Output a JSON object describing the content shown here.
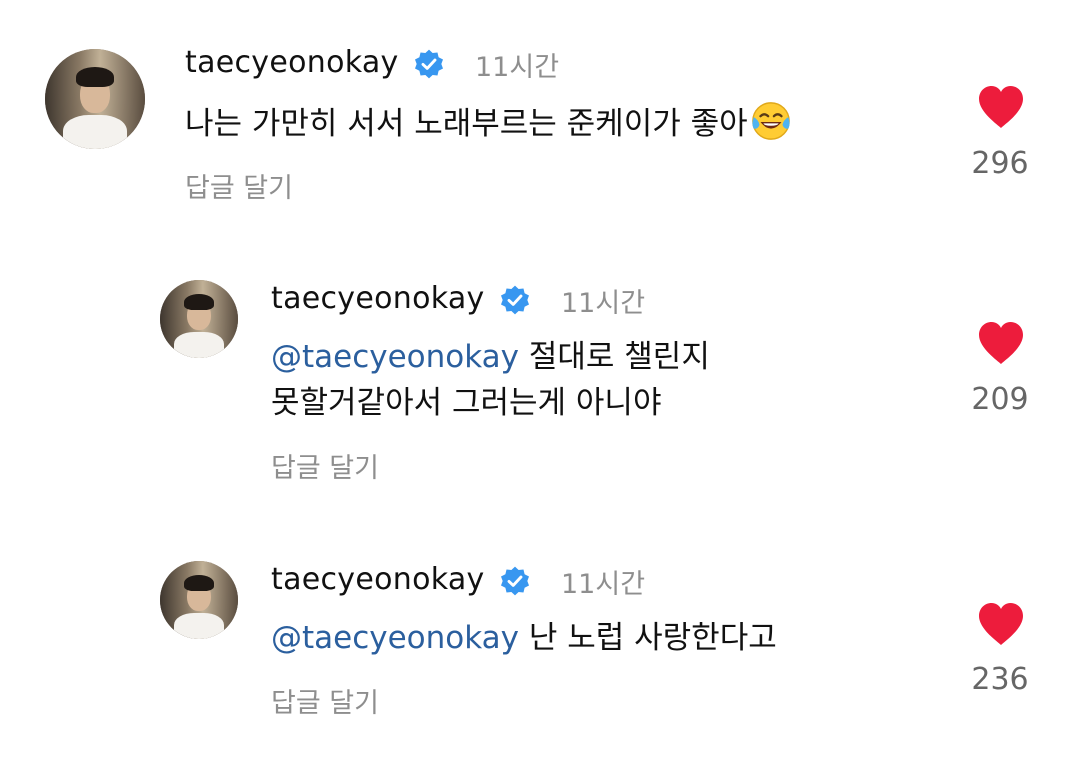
{
  "comments": [
    {
      "username": "taecyeonokay",
      "time": "11시간",
      "mention": "",
      "text": "나는 가만히 서서 노래부르는 준케이가 좋아",
      "text_line2": "",
      "emoji": "face-with-tears-of-joy",
      "reply_label": "답글 달기",
      "likes": "296"
    },
    {
      "username": "taecyeonokay",
      "time": "11시간",
      "mention": "@taecyeonokay",
      "text": " 절대로 챌린지",
      "text_line2": "못할거같아서 그러는게 아니야",
      "emoji": "",
      "reply_label": "답글 달기",
      "likes": "209"
    },
    {
      "username": "taecyeonokay",
      "time": "11시간",
      "mention": "@taecyeonokay",
      "text": " 난 노럽 사랑한다고",
      "text_line2": "",
      "emoji": "",
      "reply_label": "답글 달기",
      "likes": "236"
    }
  ],
  "colors": {
    "verified_badge": "#3897f0",
    "heart": "#ed1c3c",
    "mention": "#2b5f9e",
    "secondary_text": "#8e8e8e"
  },
  "icons": {
    "verified": "verified-badge-icon",
    "like": "heart-icon",
    "emoji": "face-with-tears-of-joy-icon"
  }
}
